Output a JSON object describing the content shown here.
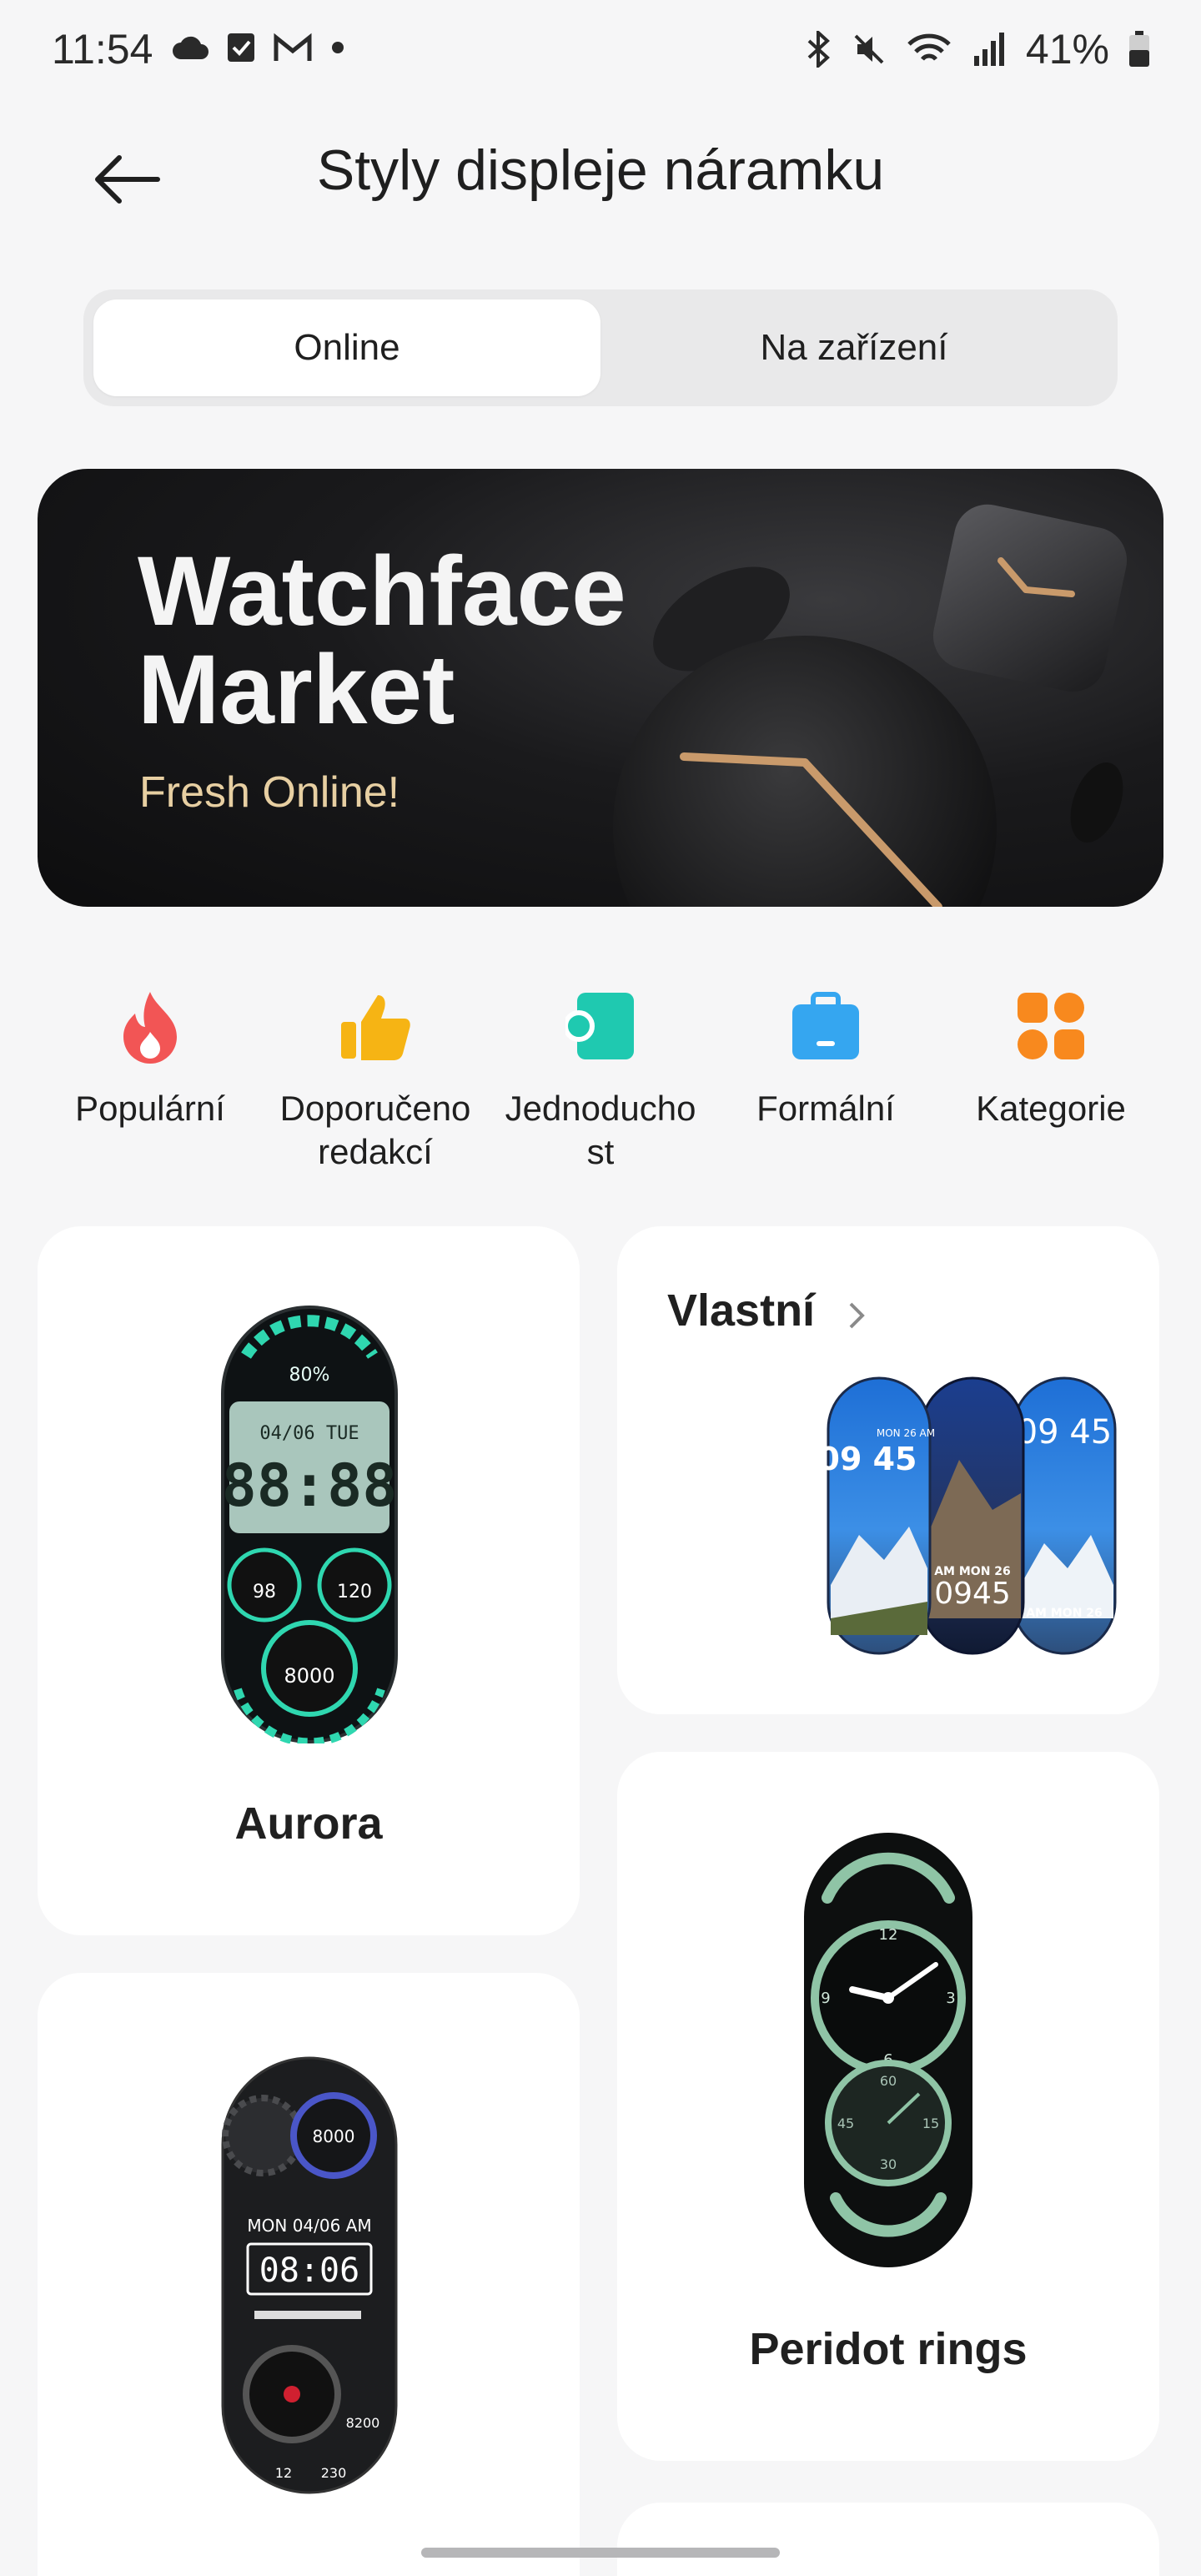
{
  "status_bar": {
    "time": "11:54",
    "battery_percent": "41%"
  },
  "header": {
    "title": "Styly displeje náramku"
  },
  "segments": {
    "online": "Online",
    "on_device": "Na zařízení",
    "selected": "online"
  },
  "banner": {
    "title_line1": "Watchface",
    "title_line2": "Market",
    "subtitle": "Fresh Online!"
  },
  "categories": [
    {
      "label": "Populární",
      "icon": "flame-icon",
      "color": "#f25555"
    },
    {
      "label": "Doporučeno redakcí",
      "icon": "thumbs-up-icon",
      "color": "#f6b414"
    },
    {
      "label": "Jednoducho st",
      "icon": "simple-icon",
      "color": "#1fc9b0"
    },
    {
      "label": "Formální",
      "icon": "briefcase-icon",
      "color": "#35a6f0"
    },
    {
      "label": "Kategorie",
      "icon": "grid-icon",
      "color": "#f8891e"
    }
  ],
  "cards": {
    "aurora": {
      "title": "Aurora",
      "battery": "80%",
      "date": "04/06 TUE",
      "time": "88:88",
      "heart": "98",
      "calories": "120",
      "steps": "8000"
    },
    "custom": {
      "title": "Vlastní",
      "face1_time": "09 45",
      "face1_date": "MON 26 AM",
      "face2_date": "AM  MON 26",
      "face2_time": "0945",
      "face3_time": "09 45",
      "face3_date": "AM  MON 26"
    },
    "peridot": {
      "title": "Peridot rings",
      "dial_numbers": [
        "12",
        "9",
        "3",
        "6"
      ],
      "sub_numbers": [
        "60",
        "45",
        "15",
        "30"
      ]
    },
    "mech": {
      "steps": "8000",
      "date": "MON 04/06 AM",
      "time": "08:06",
      "count": "8200",
      "stat1": "12",
      "stat2": "230"
    }
  },
  "colors": {
    "background": "#f6f6f7",
    "accent_gold": "#e7cfa2",
    "aurora_accent": "#2fd7b0",
    "peridot_accent": "#8fc4a6"
  }
}
